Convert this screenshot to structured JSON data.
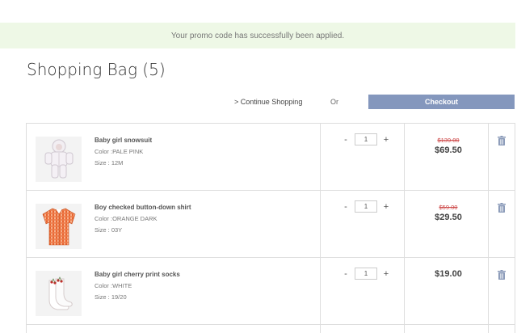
{
  "banner": {
    "message": "Your promo code has successfully been applied."
  },
  "page": {
    "title": "Shopping Bag (5)"
  },
  "actions": {
    "continue_label": "> Continue Shopping",
    "or_label": "Or",
    "checkout_label": "Checkout"
  },
  "colors": {
    "accent": "#8497bd",
    "banner_bg": "#eef8e6",
    "sale_price": "#cc4444"
  },
  "items": [
    {
      "name": "Baby girl snowsuit",
      "color_label": "Color :",
      "color": "PALE PINK",
      "size_label": "Size : ",
      "size": "12M",
      "qty_minus": "-",
      "qty_plus": "+",
      "quantity": "1",
      "old_price": "$139.00",
      "price": "$69.50",
      "icon": "snowsuit-image"
    },
    {
      "name": "Boy checked button-down shirt",
      "color_label": "Color :",
      "color": "ORANGE DARK",
      "size_label": "Size : ",
      "size": "03Y",
      "qty_minus": "-",
      "qty_plus": "+",
      "quantity": "1",
      "old_price": "$59.00",
      "price": "$29.50",
      "icon": "shirt-image"
    },
    {
      "name": "Baby girl cherry print socks",
      "color_label": "Color :",
      "color": "WHITE",
      "size_label": "Size : ",
      "size": "19/20",
      "qty_minus": "-",
      "qty_plus": "+",
      "quantity": "1",
      "old_price": "",
      "price": "$19.00",
      "icon": "socks-image"
    }
  ]
}
